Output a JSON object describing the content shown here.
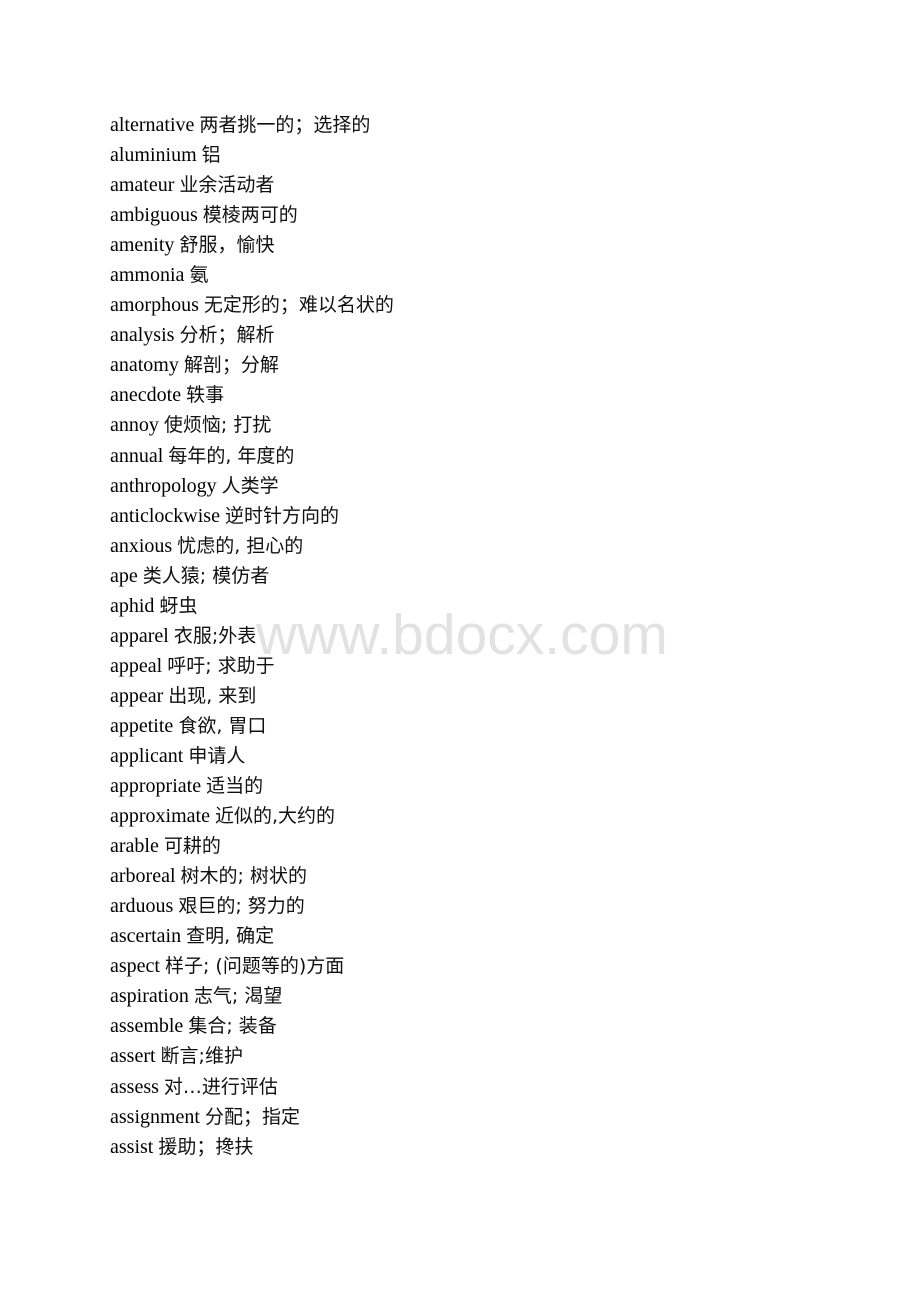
{
  "watermark": "www.bdocx.com",
  "entries": [
    {
      "word": "alternative",
      "definition": "两者挑一的；选择的"
    },
    {
      "word": "aluminium",
      "definition": "铝"
    },
    {
      "word": "amateur",
      "definition": "业余活动者"
    },
    {
      "word": "ambiguous",
      "definition": "模棱两可的"
    },
    {
      "word": "amenity",
      "definition": "舒服，愉快"
    },
    {
      "word": "ammonia",
      "definition": "氨"
    },
    {
      "word": "amorphous",
      "definition": "无定形的；难以名状的"
    },
    {
      "word": "analysis",
      "definition": "分析；解析"
    },
    {
      "word": "anatomy",
      "definition": "解剖；分解"
    },
    {
      "word": "anecdote",
      "definition": "轶事"
    },
    {
      "word": "annoy",
      "definition": "使烦恼; 打扰"
    },
    {
      "word": "annual",
      "definition": "每年的, 年度的"
    },
    {
      "word": "anthropology",
      "definition": "人类学"
    },
    {
      "word": "anticlockwise",
      "definition": "逆时针方向的"
    },
    {
      "word": "anxious",
      "definition": "忧虑的, 担心的"
    },
    {
      "word": "ape",
      "definition": "类人猿; 模仿者"
    },
    {
      "word": "aphid",
      "definition": "蚜虫"
    },
    {
      "word": "apparel",
      "definition": "衣服;外表"
    },
    {
      "word": "appeal",
      "definition": "呼吁; 求助于"
    },
    {
      "word": "appear",
      "definition": "出现, 来到"
    },
    {
      "word": "appetite",
      "definition": "食欲, 胃口"
    },
    {
      "word": "applicant",
      "definition": "申请人"
    },
    {
      "word": "appropriate",
      "definition": "适当的"
    },
    {
      "word": "approximate",
      "definition": "近似的,大约的"
    },
    {
      "word": "arable",
      "definition": "可耕的"
    },
    {
      "word": "arboreal",
      "definition": "树木的; 树状的"
    },
    {
      "word": "arduous",
      "definition": "艰巨的; 努力的"
    },
    {
      "word": "ascertain",
      "definition": "查明, 确定"
    },
    {
      "word": "aspect",
      "definition": "样子; (问题等的)方面"
    },
    {
      "word": "aspiration",
      "definition": "志气; 渴望"
    },
    {
      "word": "assemble",
      "definition": "集合; 装备"
    },
    {
      "word": "assert",
      "definition": "断言;维护"
    },
    {
      "word": "assess",
      "definition": "对…进行评估"
    },
    {
      "word": "assignment",
      "definition": "分配；指定"
    },
    {
      "word": "assist",
      "definition": "援助；搀扶"
    }
  ]
}
